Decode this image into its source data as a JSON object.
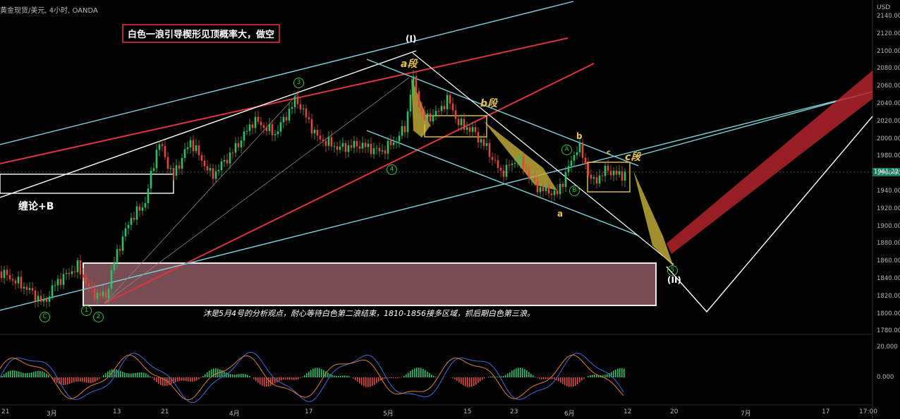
{
  "header": {
    "symbol": "黄金现货/美元, 4小时, OANDA",
    "unit": "USD",
    "banner": "白色一浪引导楔形见顶概率大，做空",
    "note": "沐是5月4号的分析观点，耐心等待白色第二浪结束，1810-1856接多区域，抓后期白色第三浪。",
    "left_label": "缠论+B"
  },
  "chart_data": {
    "type": "line",
    "title": "",
    "current_price": "1961.22",
    "y_ticks": [
      "2140.00",
      "2120.00",
      "2100.00",
      "2080.00",
      "2060.00",
      "2040.00",
      "2020.00",
      "2000.00",
      "1980.00",
      "1960.00",
      "1940.00",
      "1920.00",
      "1900.00",
      "1880.00",
      "1860.00",
      "1840.00",
      "1820.00",
      "1800.00",
      "1780.00"
    ],
    "x_ticks": [
      "21",
      "3月",
      "13",
      "21",
      "4月",
      "17",
      "5月",
      "15",
      "23",
      "6月",
      "12",
      "20",
      "7月",
      "17",
      "17:00"
    ],
    "macd_ticks": [
      "20.000",
      "0.000"
    ],
    "ylim": [
      1775,
      2150
    ],
    "zone": {
      "low": 1810,
      "high": 1856,
      "label": "1810-1856"
    },
    "segment_labels": [
      "a段",
      "b段",
      "c段"
    ],
    "wave_labels": [
      "(I)",
      "(II)",
      "1",
      "2",
      "3",
      "4",
      "5",
      "A",
      "B",
      "C",
      "a",
      "b",
      "c"
    ],
    "colors": {
      "up": "#26c26a",
      "down": "#e0483f",
      "support": "#7fd3e0",
      "resistance": "#d9363e",
      "trend": "#ffffff",
      "arrow": "#c9b23a",
      "zone": "#d88a95"
    }
  }
}
